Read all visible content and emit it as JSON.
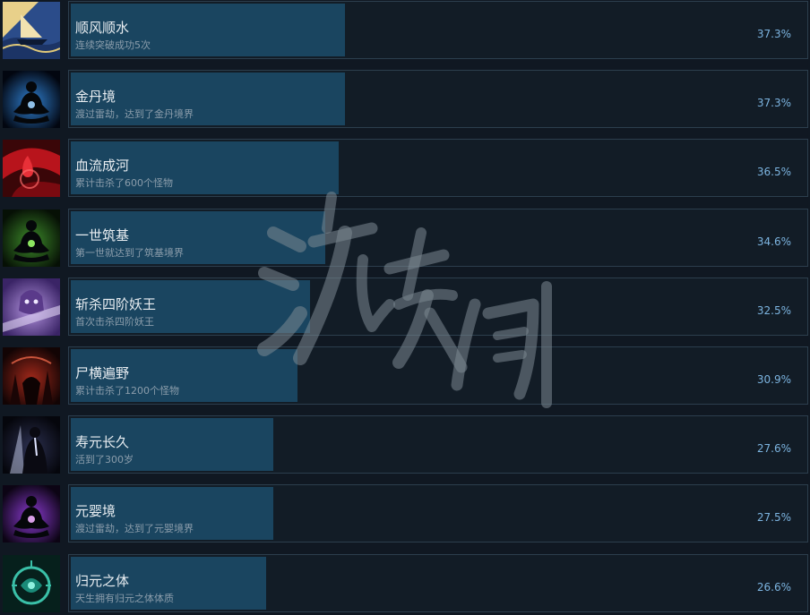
{
  "achievements": [
    {
      "title": "顺风顺水",
      "desc": "连续突破成功5次",
      "percent": "37.3%",
      "progress": 0.373,
      "icon": "ship-waves-icon",
      "accent": "#e0c878"
    },
    {
      "title": "金丹境",
      "desc": "渡过雷劫，达到了金丹境界",
      "percent": "37.3%",
      "progress": 0.373,
      "icon": "meditating-figure-blue-aura-icon",
      "accent": "#4aa8ff"
    },
    {
      "title": "血流成河",
      "desc": "累计击杀了600个怪物",
      "percent": "36.5%",
      "progress": 0.365,
      "icon": "blood-drop-icon",
      "accent": "#d02028"
    },
    {
      "title": "一世筑基",
      "desc": "第一世就达到了筑基境界",
      "percent": "34.6%",
      "progress": 0.346,
      "icon": "meditating-figure-green-aura-icon",
      "accent": "#7ee05a"
    },
    {
      "title": "斩杀四阶妖王",
      "desc": "首次击杀四阶妖王",
      "percent": "32.5%",
      "progress": 0.325,
      "icon": "demon-king-icon",
      "accent": "#a87ae0"
    },
    {
      "title": "尸横遍野",
      "desc": "累计击杀了1200个怪物",
      "percent": "30.9%",
      "progress": 0.309,
      "icon": "corpses-field-icon",
      "accent": "#c0402a"
    },
    {
      "title": "寿元长久",
      "desc": "活到了300岁",
      "percent": "27.6%",
      "progress": 0.276,
      "icon": "elder-sage-icon",
      "accent": "#b8c0e0"
    },
    {
      "title": "元婴境",
      "desc": "渡过雷劫，达到了元婴境界",
      "percent": "27.5%",
      "progress": 0.275,
      "icon": "meditating-figure-purple-aura-icon",
      "accent": "#c060ff"
    },
    {
      "title": "归元之体",
      "desc": "天生拥有归元之体体质",
      "percent": "26.6%",
      "progress": 0.266,
      "icon": "jade-dragon-emblem-icon",
      "accent": "#3ac0a8"
    }
  ],
  "watermark": "游侠网"
}
